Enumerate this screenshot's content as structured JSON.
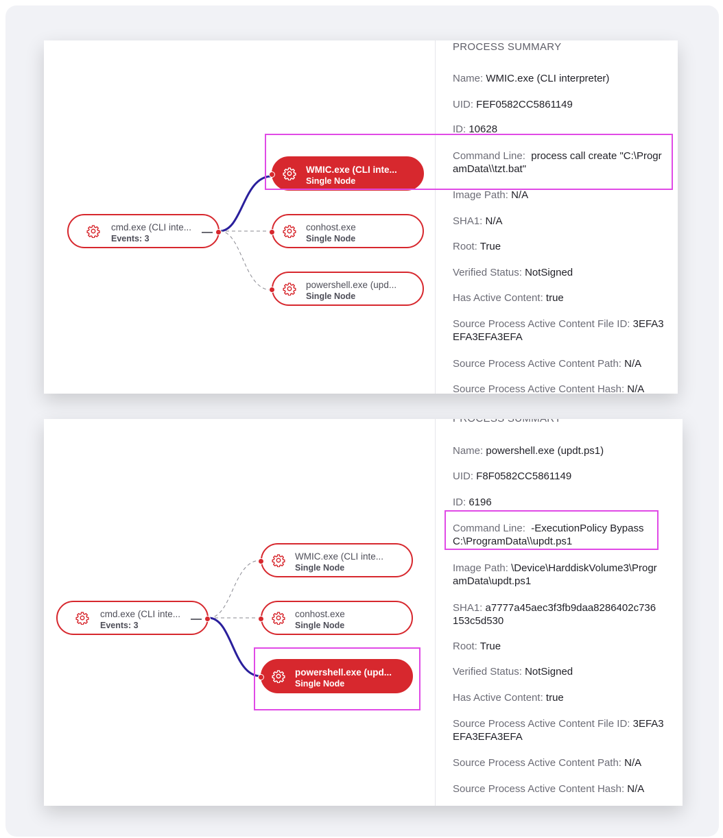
{
  "panel1": {
    "root": {
      "title": "cmd.exe (CLI inte...",
      "sub": "Events: 3"
    },
    "children": [
      {
        "title": "WMIC.exe (CLI inte...",
        "sub": "Single Node"
      },
      {
        "title": "conhost.exe",
        "sub": "Single Node"
      },
      {
        "title": "powershell.exe (upd...",
        "sub": "Single Node"
      }
    ],
    "summary": {
      "title": "PROCESS SUMMARY",
      "fields": [
        {
          "label": "Name:",
          "value": "WMIC.exe (CLI interpreter)"
        },
        {
          "label": "UID:",
          "value": "FEF0582CC5861149"
        },
        {
          "label": "ID:",
          "value": "10628"
        },
        {
          "label": "Command Line:",
          "value": "process call create \"C:\\Progr amData\\\\tzt.bat\""
        },
        {
          "label": "Image Path:",
          "value": "N/A"
        },
        {
          "label": "SHA1:",
          "value": "N/A"
        },
        {
          "label": "Root:",
          "value": "True"
        },
        {
          "label": "Verified Status:",
          "value": "NotSigned"
        },
        {
          "label": "Has Active Content:",
          "value": "true"
        },
        {
          "label": "Source Process Active Content File ID:",
          "value": "3EFA3 EFA3EFA3EFA"
        },
        {
          "label": "Source Process Active Content Path:",
          "value": "N/A"
        },
        {
          "label": "Source Process Active Content Hash:",
          "value": "N/A"
        }
      ]
    }
  },
  "panel2": {
    "root": {
      "title": "cmd.exe (CLI inte...",
      "sub": "Events: 3"
    },
    "children": [
      {
        "title": "WMIC.exe (CLI inte...",
        "sub": "Single Node"
      },
      {
        "title": "conhost.exe",
        "sub": "Single Node"
      },
      {
        "title": "powershell.exe (upd...",
        "sub": "Single Node"
      }
    ],
    "summary": {
      "title": "PROCESS SUMMARY",
      "fields": [
        {
          "label": "Name:",
          "value": "powershell.exe (updt.ps1)"
        },
        {
          "label": "UID:",
          "value": "F8F0582CC5861149"
        },
        {
          "label": "ID:",
          "value": "6196"
        },
        {
          "label": "Command Line:",
          "value": "-ExecutionPolicy Bypass C:\\ProgramData\\\\updt.ps1"
        },
        {
          "label": "Image Path:",
          "value": "\\Device\\HarddiskVolume3\\Progr amData\\updt.ps1"
        },
        {
          "label": "SHA1:",
          "value": "a7777a45aec3f3fb9daa8286402c736 153c5d530"
        },
        {
          "label": "Root:",
          "value": "True"
        },
        {
          "label": "Verified Status:",
          "value": "NotSigned"
        },
        {
          "label": "Has Active Content:",
          "value": "true"
        },
        {
          "label": "Source Process Active Content File ID:",
          "value": "3EFA3 EFA3EFA3EFA"
        },
        {
          "label": "Source Process Active Content Path:",
          "value": "N/A"
        },
        {
          "label": "Source Process Active Content Hash:",
          "value": "N/A"
        }
      ]
    }
  },
  "colors": {
    "node_red": "#d7282e",
    "edge_blue": "#2a1f9c",
    "highlight": "#e04ae6"
  },
  "icons": {
    "process": "gear-icon"
  }
}
